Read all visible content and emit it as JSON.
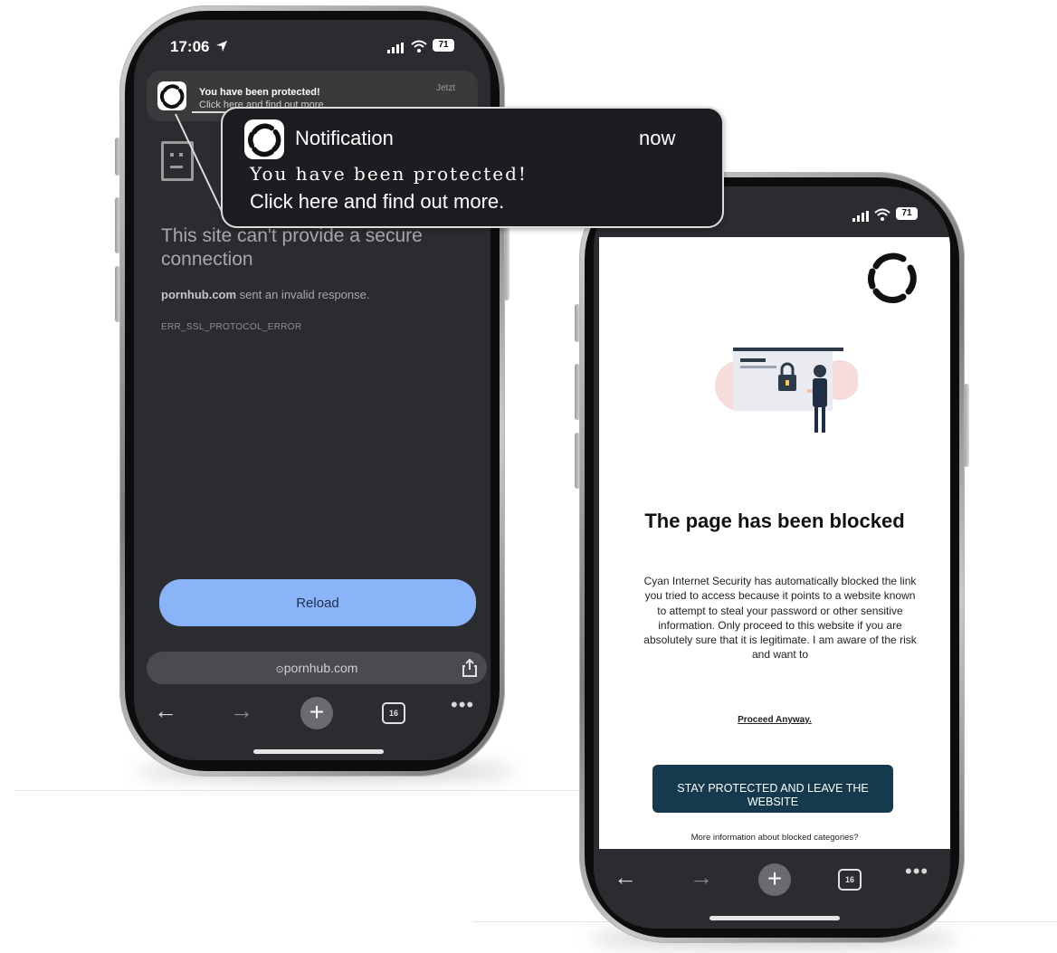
{
  "left_phone": {
    "status": {
      "time": "17:06",
      "battery": "71"
    },
    "notification": {
      "title": "You have been protected!",
      "subtitle": "Click here and find out more.",
      "time": "Jetzt"
    },
    "error": {
      "title": "This site can't provide a secure connection",
      "domain": "pornhub.com",
      "message": "sent an invalid response.",
      "code": "ERR_SSL_PROTOCOL_ERROR"
    },
    "reload_label": "Reload",
    "url": "pornhub.com",
    "tab_count": "16"
  },
  "notification_popup": {
    "app_name": "Notification",
    "time": "now",
    "line1": "You have been protected!",
    "line2": "Click here and find out more."
  },
  "right_phone": {
    "status": {
      "battery": "71"
    },
    "page": {
      "title": "The page has been blocked",
      "body": "Cyan Internet Security has automatically blocked the link you tried to access because it points to a website known to attempt to steal your password or other sensitive information. Only proceed to this website if you are absolutely sure that it is legitimate. I am aware of the risk and want to",
      "proceed_label": "Proceed Anyway.",
      "stay_button": "STAY PROTECTED AND LEAVE THE WEBSITE",
      "more_info": "More information about blocked categories?"
    },
    "tab_count": "16"
  },
  "colors": {
    "reload_button": "#8ab4f8",
    "stay_button": "#163a4d",
    "dark_screen": "#2b2c2f"
  }
}
